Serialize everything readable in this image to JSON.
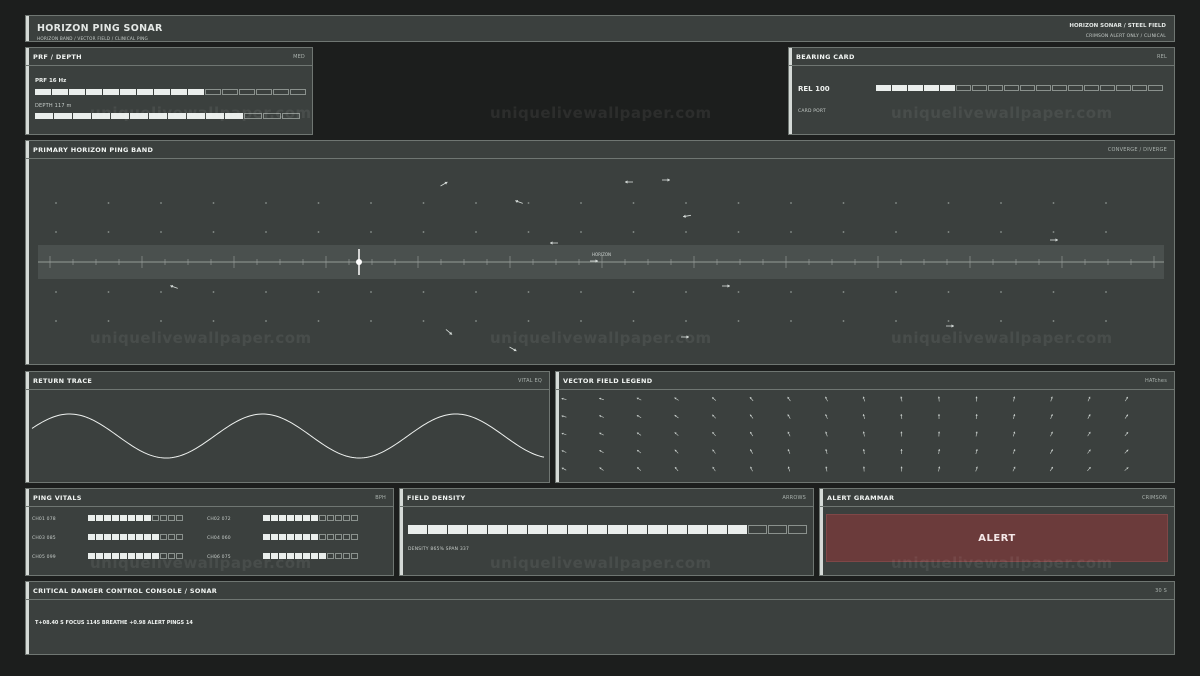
{
  "header": {
    "title": "HORIZON PING SONAR",
    "subtitle": "HORIZON BAND / VECTOR FIELD / CLINICAL PING",
    "right_title": "HORIZON SONAR / STEEL FIELD",
    "right_subtitle": "CRIMSON ALERT ONLY / CLINICAL"
  },
  "prf_depth": {
    "title": "PRF / DEPTH",
    "tag": "MED",
    "prf_label": "PRF 16 Hz",
    "prf_level": 0.6,
    "depth_label": "DEPTH 117 m",
    "depth_level": 0.78
  },
  "bearing": {
    "title": "BEARING CARD",
    "tag": "REL",
    "rel_label": "REL 100",
    "card_port": "CARD PORT",
    "level": 0.28
  },
  "primary": {
    "title": "PRIMARY HORIZON PING BAND",
    "tag": "CONVERGE / DIVERGE",
    "horizon_label": "HORIZON"
  },
  "return_trace": {
    "title": "RETURN TRACE",
    "tag": "VITAL EQ"
  },
  "vector_legend": {
    "title": "VECTOR FIELD LEGEND",
    "tag": "HATches"
  },
  "ping_vitals": {
    "title": "PING VITALS",
    "tag": "BPH",
    "channels": [
      {
        "label": "CH01 078",
        "level": 0.67
      },
      {
        "label": "CH02 072",
        "level": 0.58
      },
      {
        "label": "CH03 085",
        "level": 0.75
      },
      {
        "label": "CH04 060",
        "level": 0.58
      },
      {
        "label": "CH05 099",
        "level": 0.75
      },
      {
        "label": "CH06 075",
        "level": 0.67
      }
    ]
  },
  "field_density": {
    "title": "FIELD DENSITY",
    "tag": "ARROWS",
    "label": "DENSITY 865% SPAN 337",
    "level": 0.84
  },
  "alert_grammar": {
    "title": "ALERT GRAMMAR",
    "tag": "CRIMSON",
    "alert_label": "ALERT",
    "alert_color": "#6b3b3b"
  },
  "console": {
    "title": "CRITICAL DANGER CONTROL CONSOLE / SONAR",
    "tag": "30 S",
    "readout": "T+08.40 S FOCUS 1145 BREATHE +0.98 ALERT PINGS 14"
  },
  "watermark": "uniquelivewallpaper.com"
}
